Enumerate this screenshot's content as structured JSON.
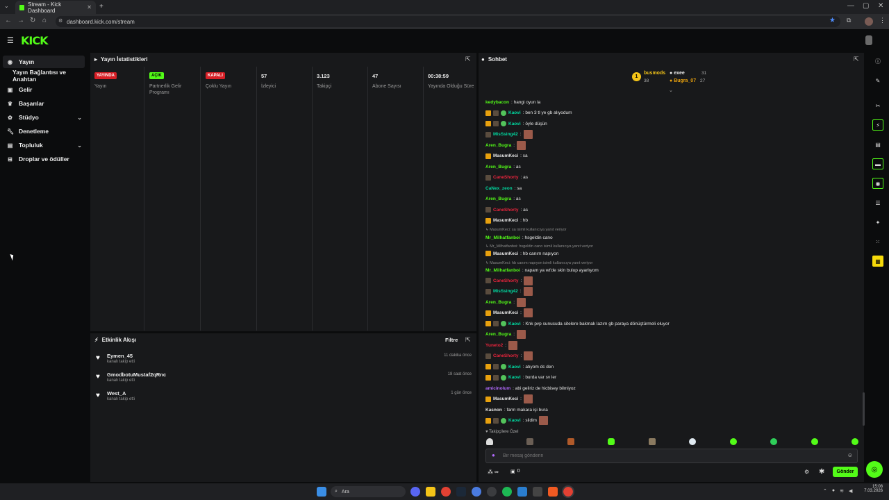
{
  "browser": {
    "tab_title": "Stream - Kick Dashboard",
    "url": "dashboard.kick.com/stream",
    "new_tab": "+"
  },
  "logo": "KICK",
  "sidebar": {
    "items": [
      {
        "label": "Yayın",
        "icon": "broadcast-icon"
      },
      {
        "label": "Yayın Bağlantısı ve Anahtarı",
        "icon": ""
      },
      {
        "label": "Gelir",
        "icon": "dollar-icon"
      },
      {
        "label": "Başarılar",
        "icon": "trophy-icon"
      },
      {
        "label": "Stüdyo",
        "icon": "palette-icon"
      },
      {
        "label": "Denetleme",
        "icon": "wrench-icon"
      },
      {
        "label": "Topluluk",
        "icon": "users-icon"
      },
      {
        "label": "Droplar ve ödüller",
        "icon": "gift-icon"
      }
    ]
  },
  "stats": {
    "title": "Yayın İstatistikleri",
    "items": [
      {
        "badge": "YAYINDA",
        "badge_color": "#d61f26",
        "label": "Yayın"
      },
      {
        "badge": "AÇIK",
        "badge_color": "#53fc18",
        "label": "Partnerlik Gelir Programı"
      },
      {
        "badge": "KAPALI",
        "badge_color": "#d61f26",
        "label": "Çoklu Yayın"
      },
      {
        "value": "57",
        "label": "İzleyici"
      },
      {
        "value": "3.123",
        "label": "Takipçi"
      },
      {
        "value": "47",
        "label": "Abone Sayısı"
      },
      {
        "value": "00:38:59",
        "label": "Yayında Olduğu Süre"
      }
    ]
  },
  "activity": {
    "title": "Etkinlik Akışı",
    "filter": "Filtre",
    "items": [
      {
        "user": "Eymen_45",
        "text": "kanalı takip etti",
        "time": "11 dakika önce"
      },
      {
        "user": "GmodbotuMustaf2qRnc",
        "text": "kanalı takip etti",
        "time": "18 saat önce"
      },
      {
        "user": "West_A",
        "text": "kanalı takip etti",
        "time": "1 gün önce"
      }
    ]
  },
  "chat": {
    "title": "Sohbet",
    "leaders": {
      "first_rank": "1",
      "first_name": "busmods",
      "first_count": "38",
      "second_name": "exee",
      "second_count": "31",
      "third_name": "Bugra_07",
      "third_count": "27"
    },
    "messages": [
      {
        "user": "kedybacon",
        "color": "#53fc18",
        "badges": "",
        "text": ": hangi oyun la"
      },
      {
        "user": "Kaovi",
        "color": "#00d9a0",
        "badges": "bmv",
        "text": ": ben 3 tl ye gb alıyodum"
      },
      {
        "user": "Kaovi",
        "color": "#00d9a0",
        "badges": "bmv",
        "text": ": öyle düşün"
      },
      {
        "user": "MisSsing42",
        "color": "#00d9a0",
        "badges": "m",
        "text": ":",
        "emote": true
      },
      {
        "user": "Aren_Bugra",
        "color": "#53fc18",
        "badges": "",
        "text": ":",
        "emote": true
      },
      {
        "user": "MasumKeci",
        "color": "#e6e6e6",
        "badges": "b",
        "text": ": sa"
      },
      {
        "user": "Aren_Bugra",
        "color": "#53fc18",
        "badges": "",
        "text": ": as"
      },
      {
        "user": "CaneShorty",
        "color": "#e8243c",
        "badges": "m",
        "text": ": as"
      },
      {
        "user": "CaNex_zeon",
        "color": "#00d9a0",
        "badges": "",
        "text": ": sa"
      },
      {
        "user": "Aren_Bugra",
        "color": "#53fc18",
        "badges": "",
        "text": ": as"
      },
      {
        "user": "CaneShorty",
        "color": "#e8243c",
        "badges": "m",
        "text": ": as"
      },
      {
        "user": "MasumKeci",
        "color": "#e6e6e6",
        "badges": "b",
        "text": ": hb"
      }
    ],
    "reply1": "↳ MasumKeci: sa isimli kullanıcıya yanıt veriyor",
    "msg13": {
      "user": "Mr_Milhatfanboi",
      "color": "#53fc18",
      "text": ": hsgeldin cano"
    },
    "reply2": "↳ Mr_Milhatfanboi: hsgeldin cano isimli kullanıcıya yanıt veriyor",
    "msg14": {
      "user": "MasumKeci",
      "color": "#e6e6e6",
      "text": ": hb canım napıyon"
    },
    "reply3": "↳ MasumKeci: hb canım napıyon isimli kullanıcıya yanıt veriyor",
    "msg15": {
      "user": "Mr_Milhatfanboi",
      "color": "#53fc18",
      "text": ": napam ya wt'de skin bulup ayarlıyom"
    },
    "messages2": [
      {
        "user": "CaneShorty",
        "color": "#e8243c",
        "badges": "m",
        "text": ":",
        "emote": true
      },
      {
        "user": "MisSsing42",
        "color": "#00d9a0",
        "badges": "m",
        "text": ":",
        "emote": true
      },
      {
        "user": "Aren_Bugra",
        "color": "#53fc18",
        "badges": "",
        "text": ":",
        "emote": true
      },
      {
        "user": "MasumKeci",
        "color": "#e6e6e6",
        "badges": "b",
        "text": ":",
        "emote": true
      },
      {
        "user": "Kaovi",
        "color": "#00d9a0",
        "badges": "bmv",
        "text": ": Knk pvp sunucuda sitelere bakmak lazım gb paraya dönüştürmeli oluyor"
      },
      {
        "user": "Aren_Bugra",
        "color": "#53fc18",
        "badges": "",
        "text": ":",
        "emote": true
      },
      {
        "user": "Yuneto2",
        "color": "#e8243c",
        "badges": "",
        "text": ":",
        "emote": true
      },
      {
        "user": "CaneShorty",
        "color": "#e8243c",
        "badges": "m",
        "text": ":",
        "emote": true
      },
      {
        "user": "Kaovi",
        "color": "#00d9a0",
        "badges": "bmv",
        "text": ": atıyom dc den"
      },
      {
        "user": "Kaovi",
        "color": "#00d9a0",
        "badges": "bmv",
        "text": ": burda var sv ler"
      },
      {
        "user": "amicinolum",
        "color": "#b36bff",
        "badges": "",
        "text": ": abi geliriz de hicbisey bilmiyoz"
      },
      {
        "user": "MasumKeci",
        "color": "#e6e6e6",
        "badges": "b",
        "text": ":",
        "emote": true
      },
      {
        "user": "Kasnon",
        "color": "#e6e6e6",
        "badges": "",
        "text": ": farm makara işi bura"
      },
      {
        "user": "Kaovi",
        "color": "#00d9a0",
        "badges": "bmv",
        "text": ": sildim",
        "emote": true
      }
    ],
    "followers_only": "♥ Takipçilere Özel",
    "input_placeholder": "Bir mesaj gönderin",
    "send": "Gönder",
    "points": "∞",
    "gifts": "0"
  },
  "taskbar": {
    "search": "Ara",
    "time": "15:08",
    "date": "7.03.2026"
  }
}
